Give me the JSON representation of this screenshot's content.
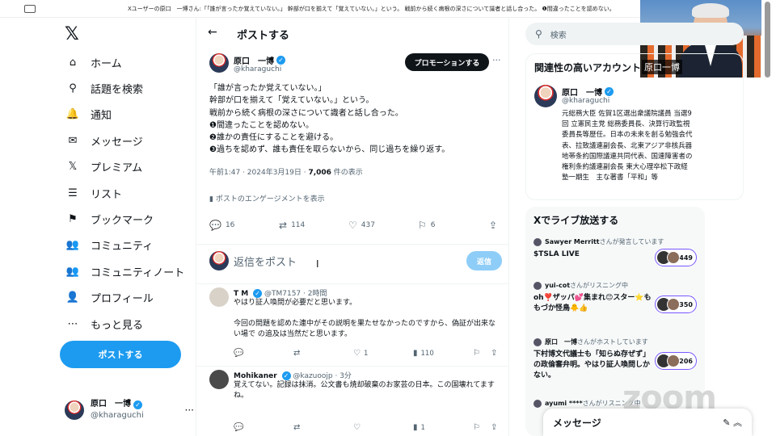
{
  "zoombar": {
    "ticker": "Xユーザーの原口　一博さん:「「誰が言ったか覚えていない。」 幹部が口を揃えて「覚えていない。」という。 戦前から続く病根の深さについて識者と話し合った。 ❶間違ったことを認めない。"
  },
  "video": {
    "name": "原口一博"
  },
  "nav": {
    "logo": "𝕏",
    "items": [
      {
        "label": "ホーム",
        "icon": "home-icon",
        "glyph": "⌂"
      },
      {
        "label": "話題を検索",
        "icon": "search-icon",
        "glyph": "⚲"
      },
      {
        "label": "通知",
        "icon": "bell-icon",
        "glyph": "🔔"
      },
      {
        "label": "メッセージ",
        "icon": "mail-icon",
        "glyph": "✉"
      },
      {
        "label": "プレミアム",
        "icon": "x-icon",
        "glyph": "𝕏"
      },
      {
        "label": "リスト",
        "icon": "list-icon",
        "glyph": "☰"
      },
      {
        "label": "ブックマーク",
        "icon": "bookmark-icon",
        "glyph": "⚑"
      },
      {
        "label": "コミュニティ",
        "icon": "community-icon",
        "glyph": "👥"
      },
      {
        "label": "コミュニティノート",
        "icon": "notes-icon",
        "glyph": "👥"
      },
      {
        "label": "プロフィール",
        "icon": "profile-icon",
        "glyph": "👤"
      },
      {
        "label": "もっと見る",
        "icon": "more-icon",
        "glyph": "⋯"
      }
    ],
    "post_button": "ポストする",
    "me": {
      "name": "原口　一博",
      "handle": "@kharaguchi",
      "more": "···"
    }
  },
  "main": {
    "title": "ポストする",
    "back": "←",
    "author": {
      "name": "原口　一博",
      "handle": "@kharaguchi"
    },
    "promo": "プロモーションする",
    "more": "···",
    "body": [
      "「誰が言ったか覚えていない。」",
      "幹部が口を揃えて「覚えていない。」という。",
      "戦前から続く病根の深さについて識者と話し合った。",
      "❶間違ったことを認めない。",
      "❷誰かの責任にすることを避ける。",
      "❸過ちを認めず、誰も責任を取らないから、同じ過ちを繰り返す。"
    ],
    "meta_time": "午前1:47 · 2024年3月19日 · ",
    "meta_views": "7,006",
    "meta_views_suffix": " 件の表示",
    "engagement": "ポストのエンゲージメントを表示",
    "actions": {
      "reply": "16",
      "repost": "114",
      "like": "437",
      "bookmark": "6"
    },
    "reply_placeholder": "返信をポスト",
    "reply_button": "返信",
    "replies": [
      {
        "name": "T M",
        "handle": "@TM7157 · 2時間",
        "text": "やはり証人喚問が必要だと思います。\n\n今回の問題を認めた連中がその説明を果たせなかったのですから、偽証が出来ない場で の追及は当然だと思います。",
        "reply": "",
        "repost": "",
        "like": "1",
        "views": "110"
      },
      {
        "name": "Mohikaner",
        "handle": "@kazuoojp · 3分",
        "text": "覚えてない。記録は抹消。公文書も焼却破棄のお家芸の日本。この国壊れてますね。",
        "reply": "",
        "repost": "",
        "like": "",
        "views": "1"
      }
    ]
  },
  "right": {
    "search_placeholder": "検索",
    "related_title": "関連性の高いアカウント",
    "account": {
      "name": "原口　一博",
      "handle": "@kharaguchi",
      "bio": "元総務大臣 佐賀1区選出衆議院議員 当選9回 立憲民主党 総務委員長、決算行政監視委員長等歴任。日本の未来を創る勉強会代表、拉致議連副会長、北東アジア非核兵器地帯条約国際議連共同代表、国連障害者の権利条約議連副会長 東大心理卒松下政経塾一期生　主な著書「平和」等"
    },
    "live_title": "Xでライブ放送する",
    "live": [
      {
        "host": "Sawyer Merritt",
        "status": "さんが発言しています",
        "title": "$TSLA LIVE",
        "count": "+449"
      },
      {
        "host": "yui-cot",
        "status": "さんがリスニング中",
        "title": "oh❣️ザッパ💕集まれ😊スター⭐ももづか怪鳥🐥👍",
        "count": "+350"
      },
      {
        "host": "原口　一博",
        "status": "さんがホストしています",
        "title": "下村博文代議士も「知らぬ存ぜず」の政倫審弁明。やはり証人喚問しかない。",
        "count": "+206"
      },
      {
        "host": "ayumi ****",
        "status": "さんがリスニング中",
        "title": "",
        "count": ""
      }
    ],
    "messages": "メッセージ"
  },
  "watermark": "zoom"
}
